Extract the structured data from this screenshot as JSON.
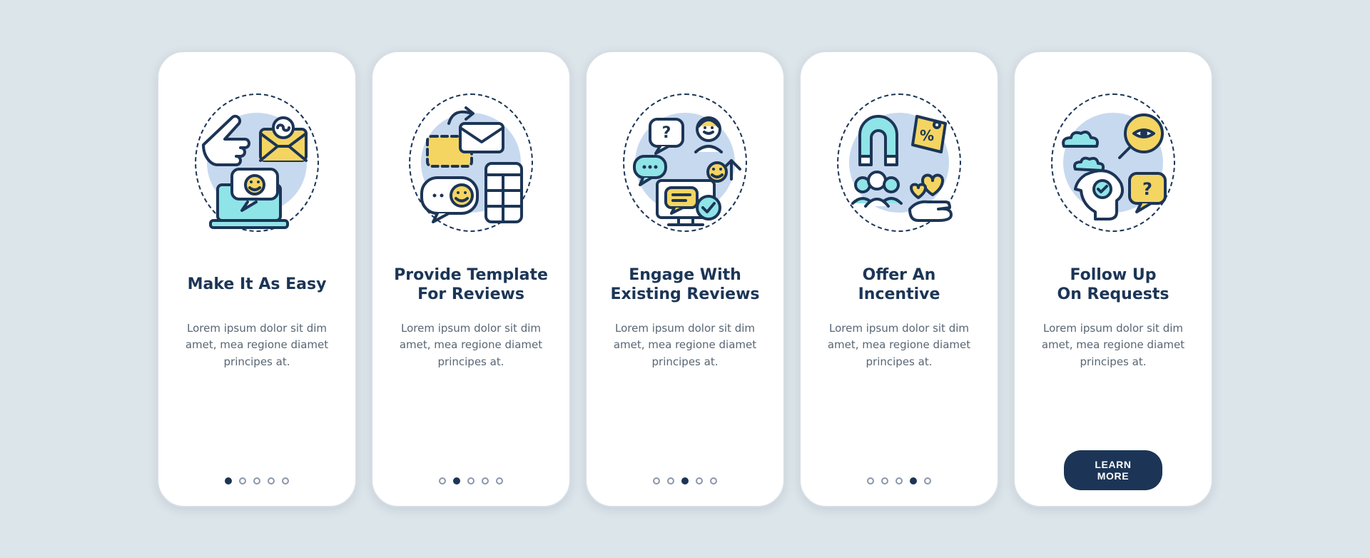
{
  "colors": {
    "navy": "#1c3556",
    "soft_blue": "#c7d9ef",
    "yellow": "#f4d562",
    "cyan": "#8fe4e7",
    "bg": "#dce5ea"
  },
  "total_slides": 5,
  "cta_label": "LEARN MORE",
  "slides": [
    {
      "index": 0,
      "title": "Make It As Easy",
      "body": "Lorem ipsum dolor sit dim amet, mea regione diamet principes at.",
      "icon": "easy-icon"
    },
    {
      "index": 1,
      "title": "Provide Template\nFor Reviews",
      "body": "Lorem ipsum dolor sit dim amet, mea regione diamet principes at.",
      "icon": "template-icon"
    },
    {
      "index": 2,
      "title": "Engage With\nExisting Reviews",
      "body": "Lorem ipsum dolor sit dim amet, mea regione diamet principes at.",
      "icon": "engage-icon"
    },
    {
      "index": 3,
      "title": "Offer An Incentive",
      "body": "Lorem ipsum dolor sit dim amet, mea regione diamet principes at.",
      "icon": "incentive-icon"
    },
    {
      "index": 4,
      "title": "Follow Up\nOn Requests",
      "body": "Lorem ipsum dolor sit dim amet, mea regione diamet principes at.",
      "icon": "followup-icon",
      "has_cta": true
    }
  ]
}
